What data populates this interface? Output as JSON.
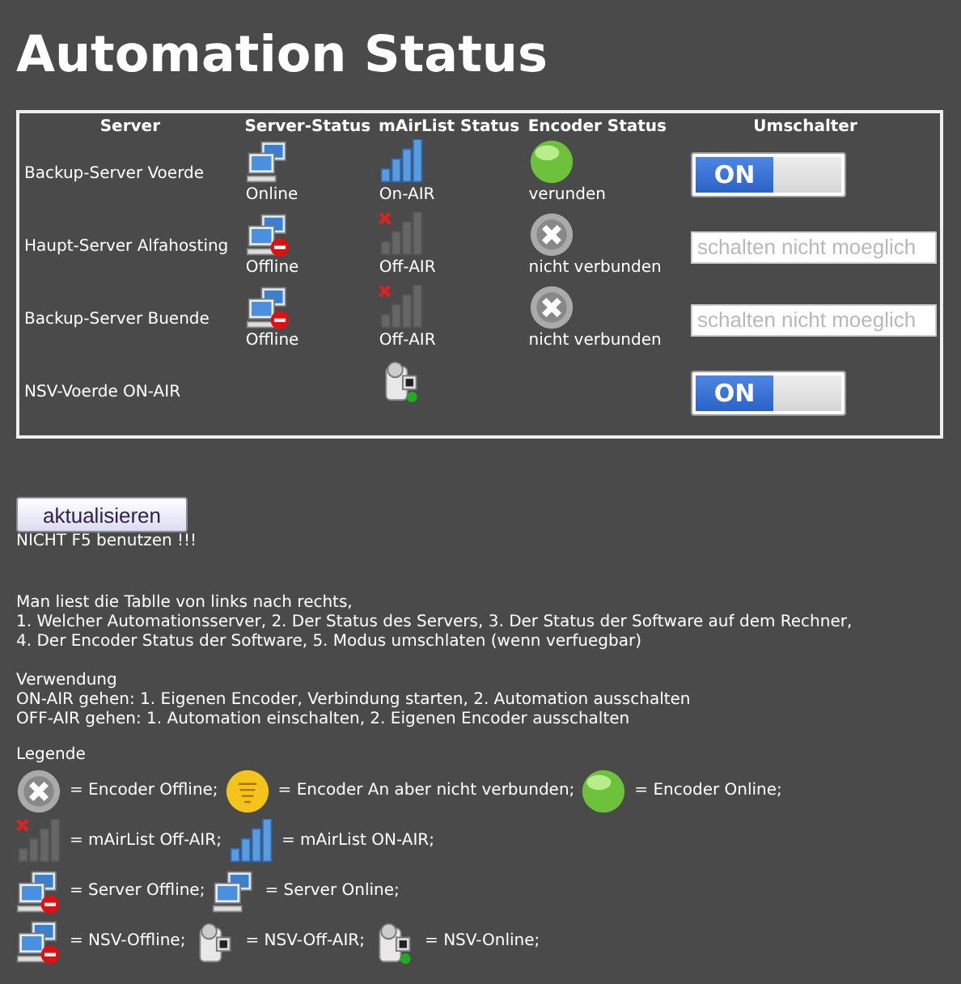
{
  "title": "Automation Status",
  "table": {
    "columns": [
      "Server",
      "Server-Status",
      "mAirList Status",
      "Encoder Status",
      "Umschalter"
    ],
    "rows": [
      {
        "server": "Backup-Server Voerde",
        "server_status": {
          "kind": "server_online",
          "label": "Online"
        },
        "mairlist": {
          "kind": "mairlist_on",
          "label": "On-AIR"
        },
        "encoder": {
          "kind": "encoder_online",
          "label": "verunden"
        },
        "switch": {
          "kind": "toggle",
          "on": true,
          "label": "ON"
        }
      },
      {
        "server": "Haupt-Server Alfahosting",
        "server_status": {
          "kind": "server_offline",
          "label": "Offline"
        },
        "mairlist": {
          "kind": "mairlist_off",
          "label": "Off-AIR"
        },
        "encoder": {
          "kind": "encoder_offline",
          "label": "nicht verbunden"
        },
        "switch": {
          "kind": "field",
          "placeholder": "schalten nicht moeglich"
        }
      },
      {
        "server": "Backup-Server Buende",
        "server_status": {
          "kind": "server_offline",
          "label": "Offline"
        },
        "mairlist": {
          "kind": "mairlist_off",
          "label": "Off-AIR"
        },
        "encoder": {
          "kind": "encoder_offline",
          "label": "nicht verbunden"
        },
        "switch": {
          "kind": "field",
          "placeholder": "schalten nicht moeglich"
        }
      },
      {
        "server": "NSV-Voerde ON-AIR",
        "mairlist": {
          "kind": "nsv_on"
        },
        "switch": {
          "kind": "toggle",
          "on": true,
          "label": "ON"
        }
      }
    ]
  },
  "refresh_button": "aktualisieren",
  "warning": "NICHT F5 benutzen !!!",
  "help": [
    "Man liest die Tablle von links nach rechts,",
    "1. Welcher Automationsserver, 2. Der Status des Servers, 3. Der Status der Software auf dem Rechner,",
    "4. Der Encoder Status der Software, 5. Modus umschlaten (wenn verfuegbar)"
  ],
  "usage": [
    "Verwendung",
    "ON-AIR gehen: 1. Eigenen Encoder, Verbindung starten, 2. Automation ausschalten",
    "OFF-AIR gehen: 1. Automation einschalten, 2. Eigenen Encoder ausschalten"
  ],
  "legend_title": "Legende",
  "legend": [
    [
      {
        "kind": "encoder_offline",
        "label": "= Encoder Offline;"
      },
      {
        "kind": "encoder_idle",
        "label": "= Encoder An aber nicht verbunden;"
      },
      {
        "kind": "encoder_online",
        "label": "= Encoder Online;"
      }
    ],
    [
      {
        "kind": "mairlist_off",
        "label": "= mAirList Off-AIR;"
      },
      {
        "kind": "mairlist_on",
        "label": "= mAirList ON-AIR;"
      }
    ],
    [
      {
        "kind": "server_offline",
        "label": "= Server Offline;"
      },
      {
        "kind": "server_online",
        "label": "= Server Online;"
      }
    ],
    [
      {
        "kind": "server_offline",
        "label": "= NSV-Offline;"
      },
      {
        "kind": "nsv_off",
        "label": "= NSV-Off-AIR;"
      },
      {
        "kind": "nsv_on",
        "label": "= NSV-Online;"
      }
    ]
  ]
}
